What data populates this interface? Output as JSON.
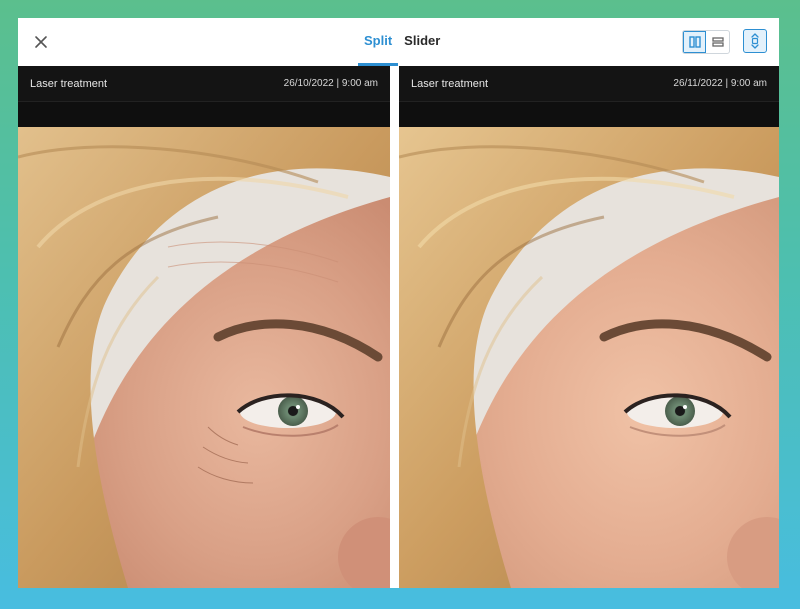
{
  "tabs": [
    {
      "label": "Split",
      "active": true
    },
    {
      "label": "Slider",
      "active": false
    }
  ],
  "icons": {
    "close": "close-icon",
    "split_vertical": "split-vertical-icon",
    "split_horizontal": "split-horizontal-icon",
    "sync": "sync-scroll-icon"
  },
  "colors": {
    "accent": "#2d8fd2",
    "header_bg": "#141414"
  },
  "panels": [
    {
      "title": "Laser treatment",
      "date": "26/10/2022 | 9:00 am"
    },
    {
      "title": "Laser treatment",
      "date": "26/11/2022 | 9:00 am"
    }
  ]
}
